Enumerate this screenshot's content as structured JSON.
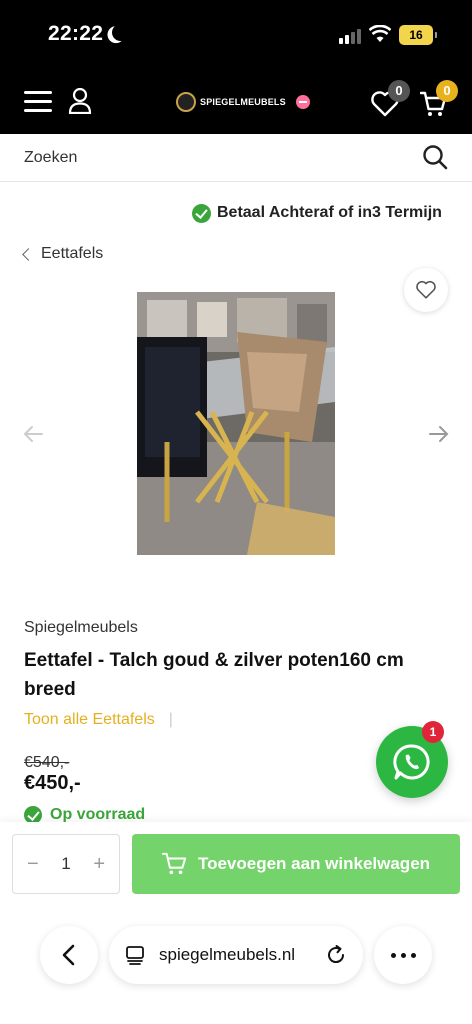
{
  "status_bar": {
    "time": "22:22",
    "battery": "16"
  },
  "header": {
    "logo_text": "SPIEGELMEUBELS",
    "wishlist_count": "0",
    "cart_count": "0"
  },
  "search": {
    "placeholder": "Zoeken"
  },
  "promo": {
    "text": "Betaal Achteraf of in3 Termijn"
  },
  "breadcrumb": {
    "label": "Eettafels"
  },
  "product": {
    "brand": "Spiegelmeubels",
    "title": "Eettafel - Talch goud & zilver poten160 cm breed",
    "category_link": "Toon alle Eettafels",
    "category_separator": "|",
    "old_price": "€540,-",
    "price": "€450,-",
    "stock": "Op voorraad"
  },
  "whatsapp": {
    "badge_count": "1"
  },
  "cart_bar": {
    "quantity": "1",
    "minus": "−",
    "plus": "+",
    "add_label": "Toevoegen aan winkelwagen"
  },
  "browser": {
    "url": "spiegelmeubels.nl"
  },
  "colors": {
    "accent_yellow": "#e4b020",
    "green": "#74d36a",
    "whatsapp": "#2cb742",
    "header_bg": "#000000"
  }
}
